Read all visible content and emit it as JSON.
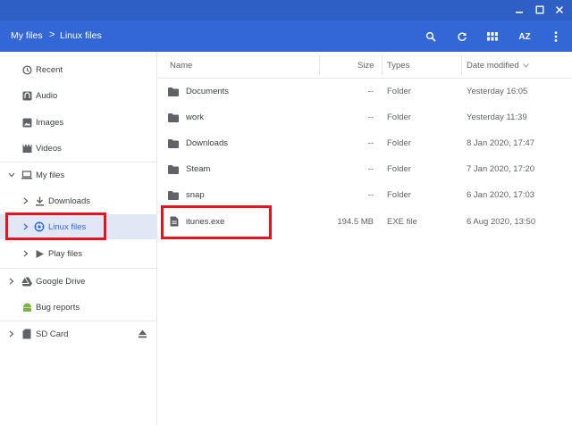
{
  "window": {
    "colors": {
      "titlebar": "#2d5fc4",
      "toolbar": "#3367d6",
      "active_bg": "#e1e7f5",
      "highlight": "#e8121f"
    }
  },
  "breadcrumb": {
    "root": "My files",
    "separator": ">",
    "current": "Linux files"
  },
  "toolbar": {
    "icons": [
      "search-icon",
      "refresh-icon",
      "grid-view-icon",
      "sort-az-icon",
      "more-vert-icon"
    ],
    "sort_label": "AZ"
  },
  "sidebar": {
    "recent": "Recent",
    "audio": "Audio",
    "images": "Images",
    "videos": "Videos",
    "my_files": "My files",
    "downloads": "Downloads",
    "linux_files": "Linux files",
    "play_files": "Play files",
    "google_drive": "Google Drive",
    "bug_reports": "Bug reports",
    "sd_card": "SD Card"
  },
  "table": {
    "headers": {
      "name": "Name",
      "size": "Size",
      "types": "Types",
      "date": "Date modified"
    },
    "rows": [
      {
        "name": "Documents",
        "size": "--",
        "type": "Folder",
        "date": "Yesterday 16:05",
        "icon": "folder-icon"
      },
      {
        "name": "work",
        "size": "--",
        "type": "Folder",
        "date": "Yesterday 11:39",
        "icon": "folder-icon"
      },
      {
        "name": "Downloads",
        "size": "--",
        "type": "Folder",
        "date": "8 Jan 2020, 17:47",
        "icon": "folder-icon"
      },
      {
        "name": "Steam",
        "size": "--",
        "type": "Folder",
        "date": "7 Jan 2020, 17:20",
        "icon": "folder-icon"
      },
      {
        "name": "snap",
        "size": "--",
        "type": "Folder",
        "date": "6 Jan 2020, 17:03",
        "icon": "folder-icon"
      },
      {
        "name": "itunes.exe",
        "size": "194.5 MB",
        "type": "EXE file",
        "date": "6 Aug 2020, 13:50",
        "icon": "file-icon"
      }
    ]
  }
}
